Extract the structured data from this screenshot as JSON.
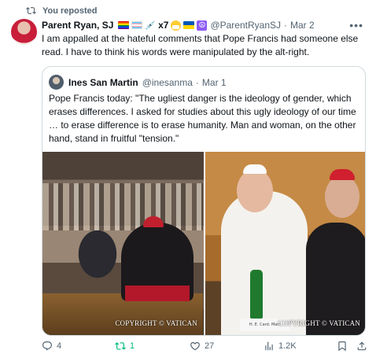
{
  "repost": {
    "label": "You reposted"
  },
  "post": {
    "author": {
      "display_name": "Parent Ryan, SJ",
      "emoji_suffix": "x7",
      "handle": "@ParentRyanSJ",
      "date": "Mar 2"
    },
    "separator": "·",
    "text": "I am appalled at the hateful comments that Pope Francis had someone else read. I have to think his words were manipulated by the alt-right.",
    "quoted": {
      "display_name": "Ines San Martin",
      "handle": "@inesanma",
      "date": "Mar 1",
      "text": "Pope Francis today: \"The ugliest danger is the ideology of gender, which erases differences. I asked for studies about this ugly ideology of our time … to erase difference is to erase humanity. Man and woman, on the other hand, stand in fruitful \"tension.\"",
      "images": [
        {
          "watermark": "COPYRIGHT © VATICAN"
        },
        {
          "watermark": "COPYRIGHT © VATICAN",
          "nameplate": "H. E. Card. Marc"
        }
      ]
    },
    "actions": {
      "replies": "4",
      "reposts": "1",
      "likes": "27",
      "views": "1.2K"
    }
  },
  "colors": {
    "text": "#0f1419",
    "muted": "#536471",
    "border": "#cfd9de",
    "repost_active": "#00ba7c"
  }
}
